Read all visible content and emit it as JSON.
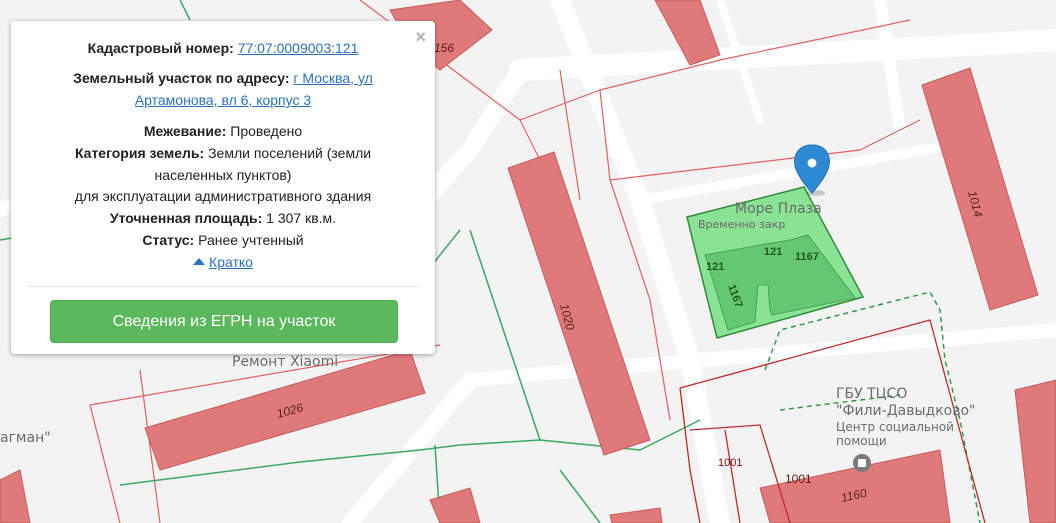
{
  "map": {
    "poi": {
      "repair_shop": "Ремонт Xiaomi",
      "flagman": "агман\"",
      "more_plaza": "Море Плаза",
      "more_plaza_sub": "Временно закр",
      "gbu_line1": "ГБУ ТЦСО",
      "gbu_line2": "\"Фили-Давыдково\"",
      "gbu_line3": "Центр социальной",
      "gbu_line4": "помощи"
    },
    "buildings": {
      "b156": "156",
      "b1020": "1020",
      "b1014": "1014",
      "b1026": "1026",
      "b1160": "1160",
      "b1001": "1001"
    },
    "plot_labels": {
      "a": "121",
      "b": "121",
      "c": "1167",
      "d": "1167"
    },
    "cadastral_label": "1001"
  },
  "popup": {
    "cad_label": "Кадастровый номер:",
    "cad_value": "77:07:0009003:121",
    "address_label": "Земельный участок по адресу:",
    "address_value_1": "г Москва, ул",
    "address_value_2": "Артамонова, вл 6, корпус 3",
    "survey_label": "Межевание:",
    "survey_value": "Проведено",
    "category_label": "Категория земель:",
    "category_value_1": "Земли поселений (земли",
    "category_value_2": "населенных пунктов)",
    "usage": "для эксплуатации административного здания",
    "area_label": "Уточненная площадь:",
    "area_value": "1 307 кв.м.",
    "status_label": "Статус:",
    "status_value": "Ранее учтенный",
    "toggle": "Кратко",
    "close": "×",
    "egrn_button": "Сведения из ЕГРН на участок"
  },
  "colors": {
    "building_fill": "#e07a7a",
    "plot_fill": "#7ee08a",
    "button": "#5cb85c",
    "link": "#2a72c2",
    "marker": "#2f8ad6"
  }
}
